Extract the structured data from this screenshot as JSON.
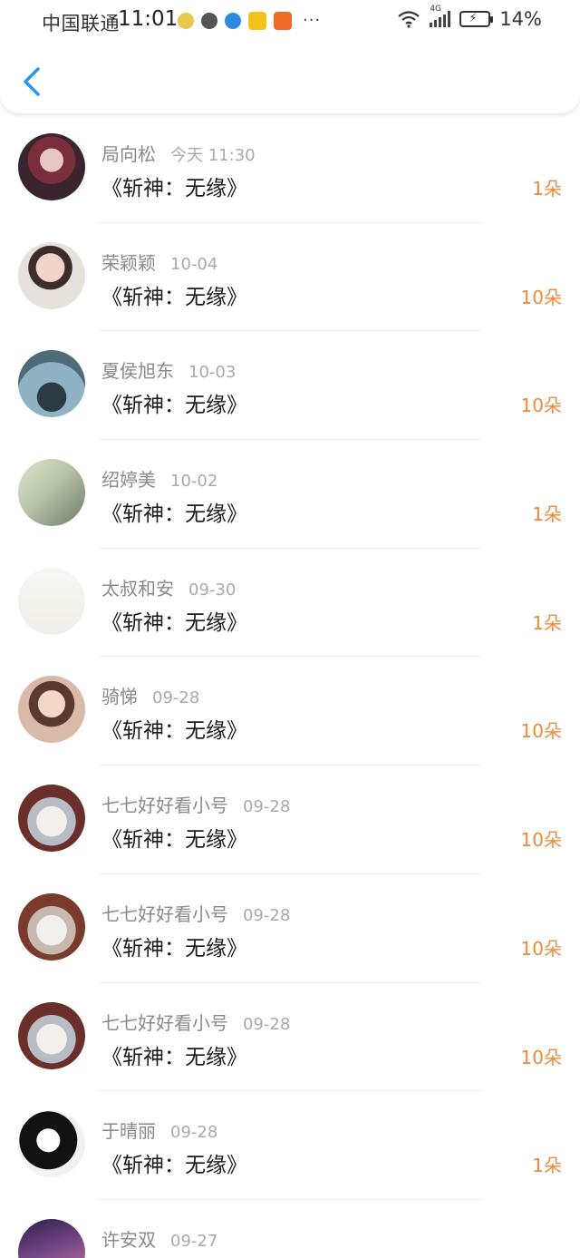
{
  "status_bar": {
    "carrier": "中国联通",
    "time": "11:01",
    "network": "4G",
    "battery": "14%",
    "more": "···"
  },
  "nav": {
    "back_icon": "chevron-left-icon"
  },
  "colors": {
    "accent": "#2196f3",
    "amount": "#ee8a3a"
  },
  "records": [
    {
      "name": "局向松",
      "date": "今天 11:30",
      "title": "《斩神：无缘》",
      "amount": "1朵"
    },
    {
      "name": "荣颖颖",
      "date": "10-04",
      "title": "《斩神：无缘》",
      "amount": "10朵"
    },
    {
      "name": "夏侯旭东",
      "date": "10-03",
      "title": "《斩神：无缘》",
      "amount": "10朵"
    },
    {
      "name": "绍婷美",
      "date": "10-02",
      "title": "《斩神：无缘》",
      "amount": "1朵"
    },
    {
      "name": "太叔和安",
      "date": "09-30",
      "title": "《斩神：无缘》",
      "amount": "1朵"
    },
    {
      "name": "骑悌",
      "date": "09-28",
      "title": "《斩神：无缘》",
      "amount": "10朵"
    },
    {
      "name": "七七好好看小号",
      "date": "09-28",
      "title": "《斩神：无缘》",
      "amount": "10朵"
    },
    {
      "name": "七七好好看小号",
      "date": "09-28",
      "title": "《斩神：无缘》",
      "amount": "10朵"
    },
    {
      "name": "七七好好看小号",
      "date": "09-28",
      "title": "《斩神：无缘》",
      "amount": "10朵"
    },
    {
      "name": "于晴丽",
      "date": "09-28",
      "title": "《斩神：无缘》",
      "amount": "1朵"
    },
    {
      "name": "许安双",
      "date": "09-27"
    }
  ]
}
